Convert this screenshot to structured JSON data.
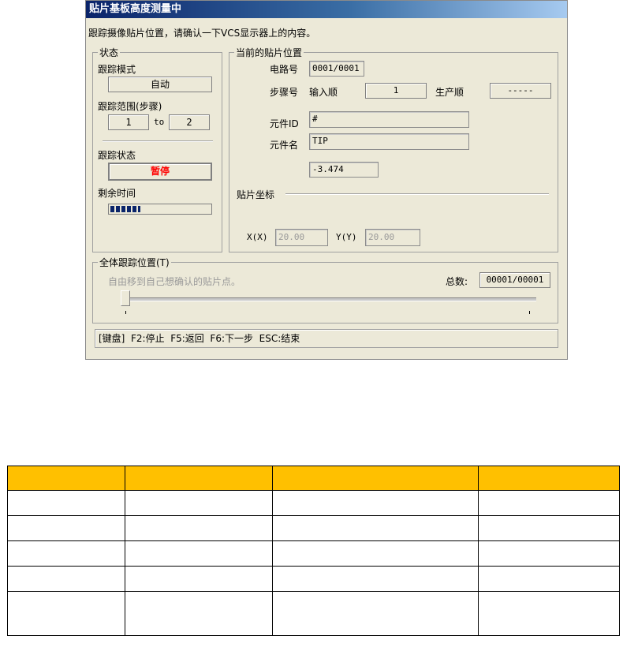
{
  "dialog": {
    "title": "贴片基板高度测量中",
    "intro": "跟踪摄像贴片位置，请确认一下VCS显示器上的内容。"
  },
  "status_group": {
    "legend": "状态",
    "mode_label": "跟踪模式",
    "mode_value": "自动",
    "range_label": "跟踪范围(步骤)",
    "range_from": "1",
    "range_to_label": "to",
    "range_to": "2",
    "state_label": "跟踪状态",
    "state_value": "暂停",
    "state_color": "#ff0000",
    "remaining_label": "剩余时间",
    "remaining_progress": 0.3
  },
  "position_group": {
    "legend": "当前的贴片位置",
    "circuit_label": "电路号",
    "circuit_value": "0001/0001",
    "step_label": "步骤号",
    "input_order_label": "输入顺",
    "input_order_value": "1",
    "prod_order_label": "生产顺",
    "prod_order_value": "-----",
    "part_id_label": "元件ID",
    "part_id_value": "#",
    "part_name_label": "元件名",
    "part_name_value": "TIP",
    "height_value": "-3.474",
    "coord_legend": "贴片坐标",
    "x_label": "X(X)",
    "x_value": "20.00",
    "y_label": "Y(Y)",
    "y_value": "20.00"
  },
  "overall_group": {
    "legend": "全体跟踪位置(T)",
    "hint": "自由移到自己想确认的贴片点。",
    "total_label": "总数:",
    "total_value": "00001/00001",
    "slider_position": 0
  },
  "statusbar": {
    "text": "[键盘]  F2:停止  F5:返回  F6:下一步  ESC:结束"
  },
  "table": {
    "rows": 5,
    "columns": 4,
    "header_color": "#ffc000"
  }
}
